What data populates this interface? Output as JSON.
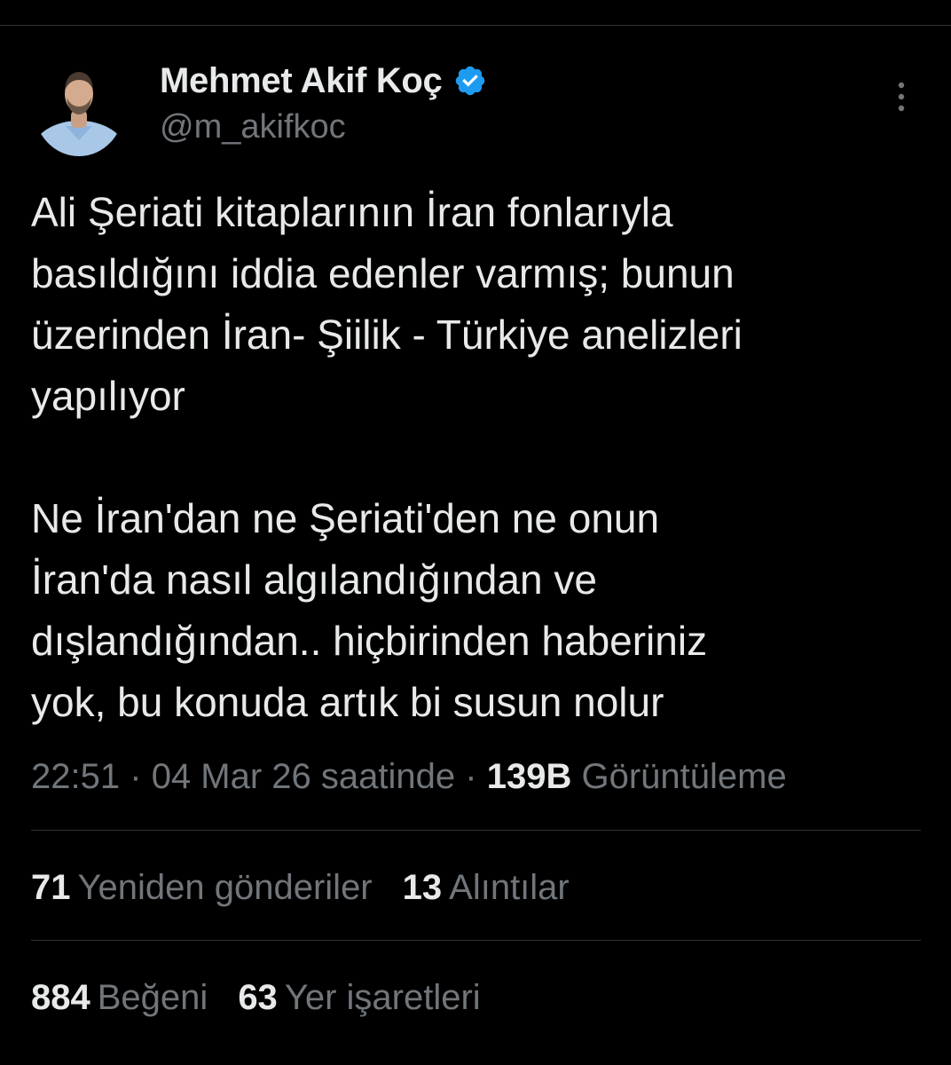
{
  "author": {
    "display_name": "Mehmet Akif Koç",
    "handle": "@m_akifkoc",
    "verified": true,
    "avatar_icon": "profile-photo"
  },
  "tweet": {
    "text": "Ali Şeriati kitaplarının İran fonlarıyla\nbasıldığını iddia edenler varmış; bunun\nüzerinden İran- Şiilik - Türkiye anelizleri\nyapılıyor\n\nNe İran'dan ne Şeriati'den ne onun\nİran'da nasıl algılandığından ve\ndışlandığından.. hiçbirinden haberiniz\nyok, bu konuda artık bi susun nolur",
    "time": "22:51",
    "separator": "·",
    "date": "04 Mar 26 saatinde",
    "views_count": "139B",
    "views_label": "Görüntüleme"
  },
  "stats": {
    "retweets": {
      "count": "71",
      "label": "Yeniden gönderiler"
    },
    "quotes": {
      "count": "13",
      "label": "Alıntılar"
    },
    "likes": {
      "count": "884",
      "label": "Beğeni"
    },
    "bookmarks": {
      "count": "63",
      "label": "Yer işaretleri"
    }
  },
  "colors": {
    "background": "#000000",
    "text_primary": "#e7e9ea",
    "text_secondary": "#71767b",
    "divider": "#2f3336",
    "verified_blue": "#1d9bf0"
  },
  "icons": {
    "verified": "verified-badge-icon",
    "more": "more-vertical-icon"
  }
}
